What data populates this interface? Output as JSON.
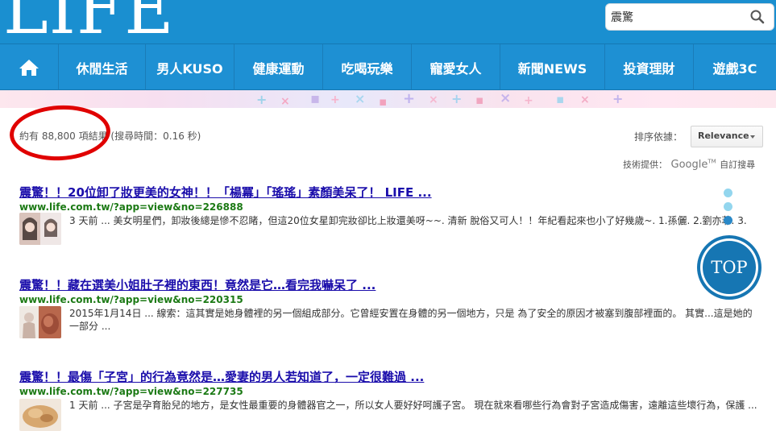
{
  "header": {
    "logo": "LIFE"
  },
  "search": {
    "value": "震驚"
  },
  "nav": {
    "items": [
      "休閒生活",
      "男人KUSO",
      "健康運動",
      "吃喝玩樂",
      "寵愛女人",
      "新聞NEWS",
      "投資理財",
      "遊戲3C"
    ]
  },
  "stats": {
    "text": "約有 88,800 項結果 (搜尋時間：0.16 秒)"
  },
  "sort": {
    "label": "排序依據：",
    "value": "Relevance"
  },
  "powered": {
    "prefix": "技術提供：",
    "brand": "Google",
    "tm": "TM",
    "suffix": "自訂搜尋"
  },
  "results": [
    {
      "title_em": "震驚",
      "title_rest": "！！20位卸了妝更美的女神！！「楊冪」「瑤瑤」素顏美呆了！ LIFE ...",
      "url": "www.life.com.tw/?app=view&no=226888",
      "snippet": "3 天前 ... 美女明星們，卸妝後總是慘不忍睹，但這20位女星卸完妝卻比上妝還美呀~~. 清新 脫俗又可人！！年紀看起來也小了好幾歲~. 1.孫儷. 2.劉亦菲. 3."
    },
    {
      "title_em": "震驚",
      "title_rest": "！！藏在選美小姐肚子裡的東西！竟然是它…看完我嚇呆了 ...",
      "url": "www.life.com.tw/?app=view&no=220315",
      "snippet": "2015年1月14日 ... 線索：這其實是她身體裡的另一個組成部分。它曾經安置在身體的另一個地方，只是 為了安全的原因才被塞到腹部裡面的。 其實...這是她的一部分 ..."
    },
    {
      "title_em": "震驚",
      "title_rest": "！！最傷「子宮」的行為竟然是…愛妻的男人若知道了，一定很難過 ...",
      "url": "www.life.com.tw/?app=view&no=227735",
      "snippet": "1 天前 ... 子宮是孕育胎兒的地方，是女性最重要的身體器官之一，所以女人要好好呵護子宮。 現在就來看哪些行為會對子宮造成傷害，遠離這些壞行為，保護 ..."
    }
  ],
  "top_button": {
    "label": "TOP"
  },
  "colors": {
    "nav_blue": "#1e90d3",
    "link": "#1a0dab",
    "url_green": "#1c7a15",
    "annotation_red": "#e00000"
  }
}
